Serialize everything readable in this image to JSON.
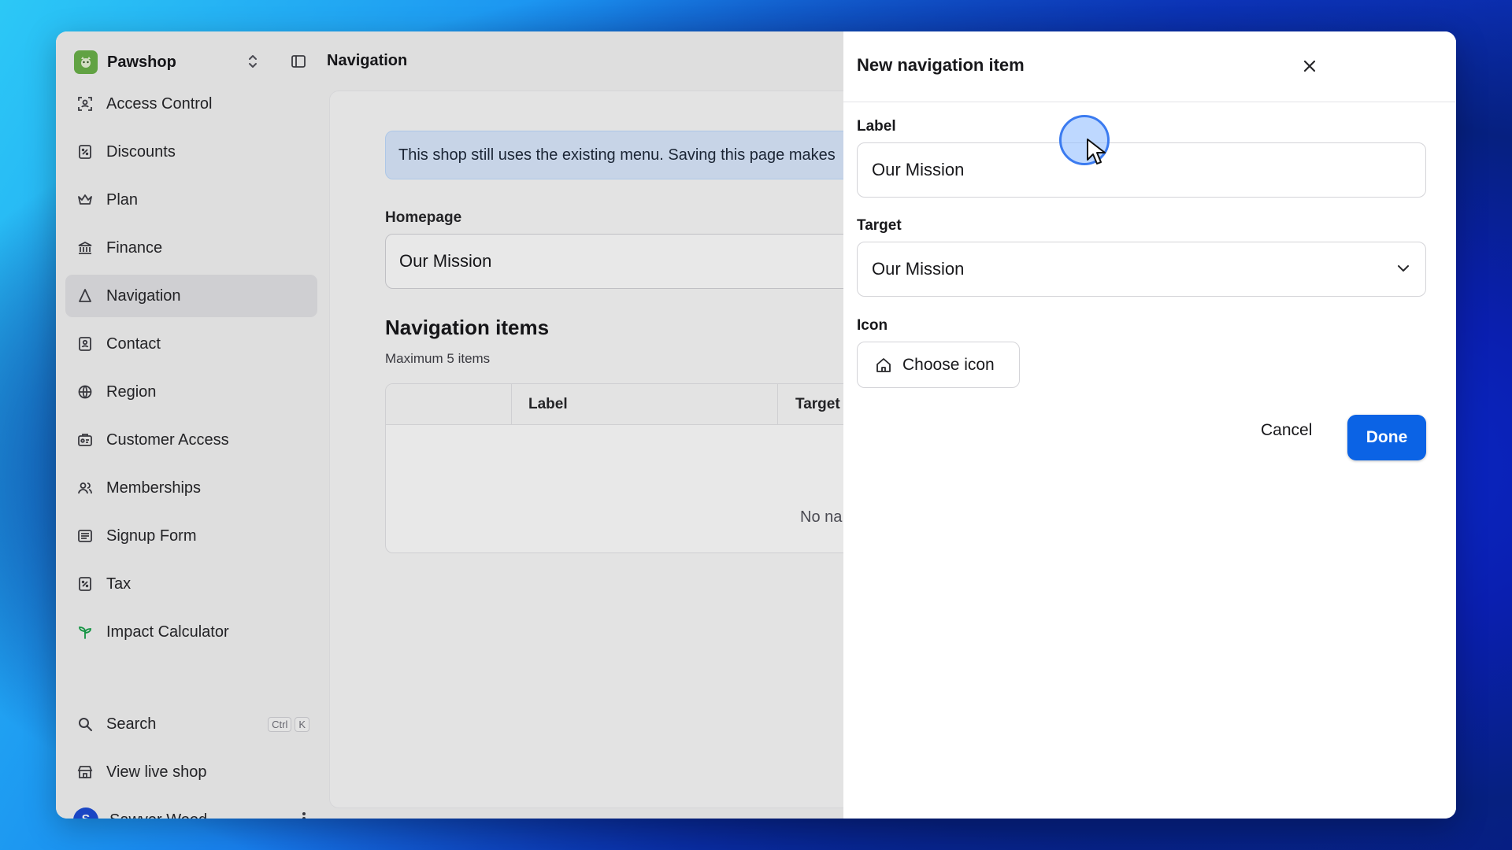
{
  "brand": {
    "name": "Pawshop"
  },
  "topbar": {
    "title": "Navigation"
  },
  "sidebar": {
    "items": [
      {
        "label": "Access Control",
        "icon": "access-control-icon"
      },
      {
        "label": "Discounts",
        "icon": "discount-icon"
      },
      {
        "label": "Plan",
        "icon": "crown-icon"
      },
      {
        "label": "Finance",
        "icon": "bank-icon"
      },
      {
        "label": "Navigation",
        "icon": "navigation-icon",
        "active": true
      },
      {
        "label": "Contact",
        "icon": "contact-icon"
      },
      {
        "label": "Region",
        "icon": "globe-icon"
      },
      {
        "label": "Customer Access",
        "icon": "customer-access-icon"
      },
      {
        "label": "Memberships",
        "icon": "users-icon"
      },
      {
        "label": "Signup Form",
        "icon": "form-icon"
      },
      {
        "label": "Tax",
        "icon": "tax-icon"
      },
      {
        "label": "Impact Calculator",
        "icon": "sprout-icon"
      }
    ],
    "search": {
      "label": "Search",
      "shortcut_1": "Ctrl",
      "shortcut_2": "K"
    },
    "live_shop": {
      "label": "View live shop"
    },
    "user": {
      "initial": "S",
      "name": "Sawyer Wood"
    }
  },
  "main": {
    "notice": "This shop still uses the existing menu. Saving this page makes",
    "homepage": {
      "label": "Homepage",
      "value": "Our Mission"
    },
    "nav_items": {
      "title": "Navigation items",
      "subtitle": "Maximum 5 items",
      "columns": [
        "Label",
        "Target"
      ],
      "empty_text": "No na"
    }
  },
  "dialog": {
    "title": "New navigation item",
    "label_field": {
      "label": "Label",
      "value": "Our Mission"
    },
    "target_field": {
      "label": "Target",
      "value": "Our Mission"
    },
    "icon_field": {
      "label": "Icon",
      "button": "Choose icon"
    },
    "cancel": "Cancel",
    "done": "Done"
  },
  "colors": {
    "accent": "#0b63e5",
    "brand": "#6bb34a",
    "notice_bg": "#dbeafe"
  }
}
